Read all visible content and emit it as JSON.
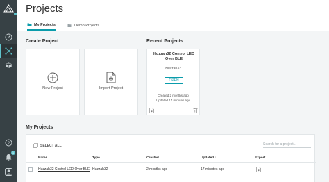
{
  "header": {
    "title": "Projects",
    "tabs": [
      {
        "label": "My Projects",
        "active": true
      },
      {
        "label": "Demo Projects",
        "active": false
      }
    ]
  },
  "sidebar": {
    "icons": [
      "logo-icon",
      "dashboard-icon",
      "projects-icon",
      "cube-icon",
      "help-icon",
      "notifications-icon",
      "user-icon"
    ],
    "notification_count": "1"
  },
  "create_project": {
    "title": "Create Project",
    "new_label": "New Project",
    "import_label": "Import Project"
  },
  "recent_projects": {
    "title": "Recent Projects",
    "card": {
      "name": "Huzzah32 Control LED Over BLE",
      "type": "Huzzah32",
      "open_label": "OPEN",
      "created": "Created 2 months ago",
      "updated": "Updated 17 minutes ago"
    }
  },
  "my_projects": {
    "title": "My Projects",
    "select_all": "SELECT ALL",
    "search_placeholder": "Search for a project...",
    "columns": {
      "name": "Name",
      "type": "Type",
      "created": "Created",
      "updated": "Updated ↓",
      "export": "Export"
    },
    "rows": [
      {
        "name": "Huzzah32 Control LED Over BLE",
        "type": "Huzzah32",
        "created": "2 months ago",
        "updated": "17 minutes ago"
      }
    ]
  },
  "colors": {
    "accent": "#0a9cab",
    "sidebar": "#374145",
    "background": "#f3f5f6"
  }
}
